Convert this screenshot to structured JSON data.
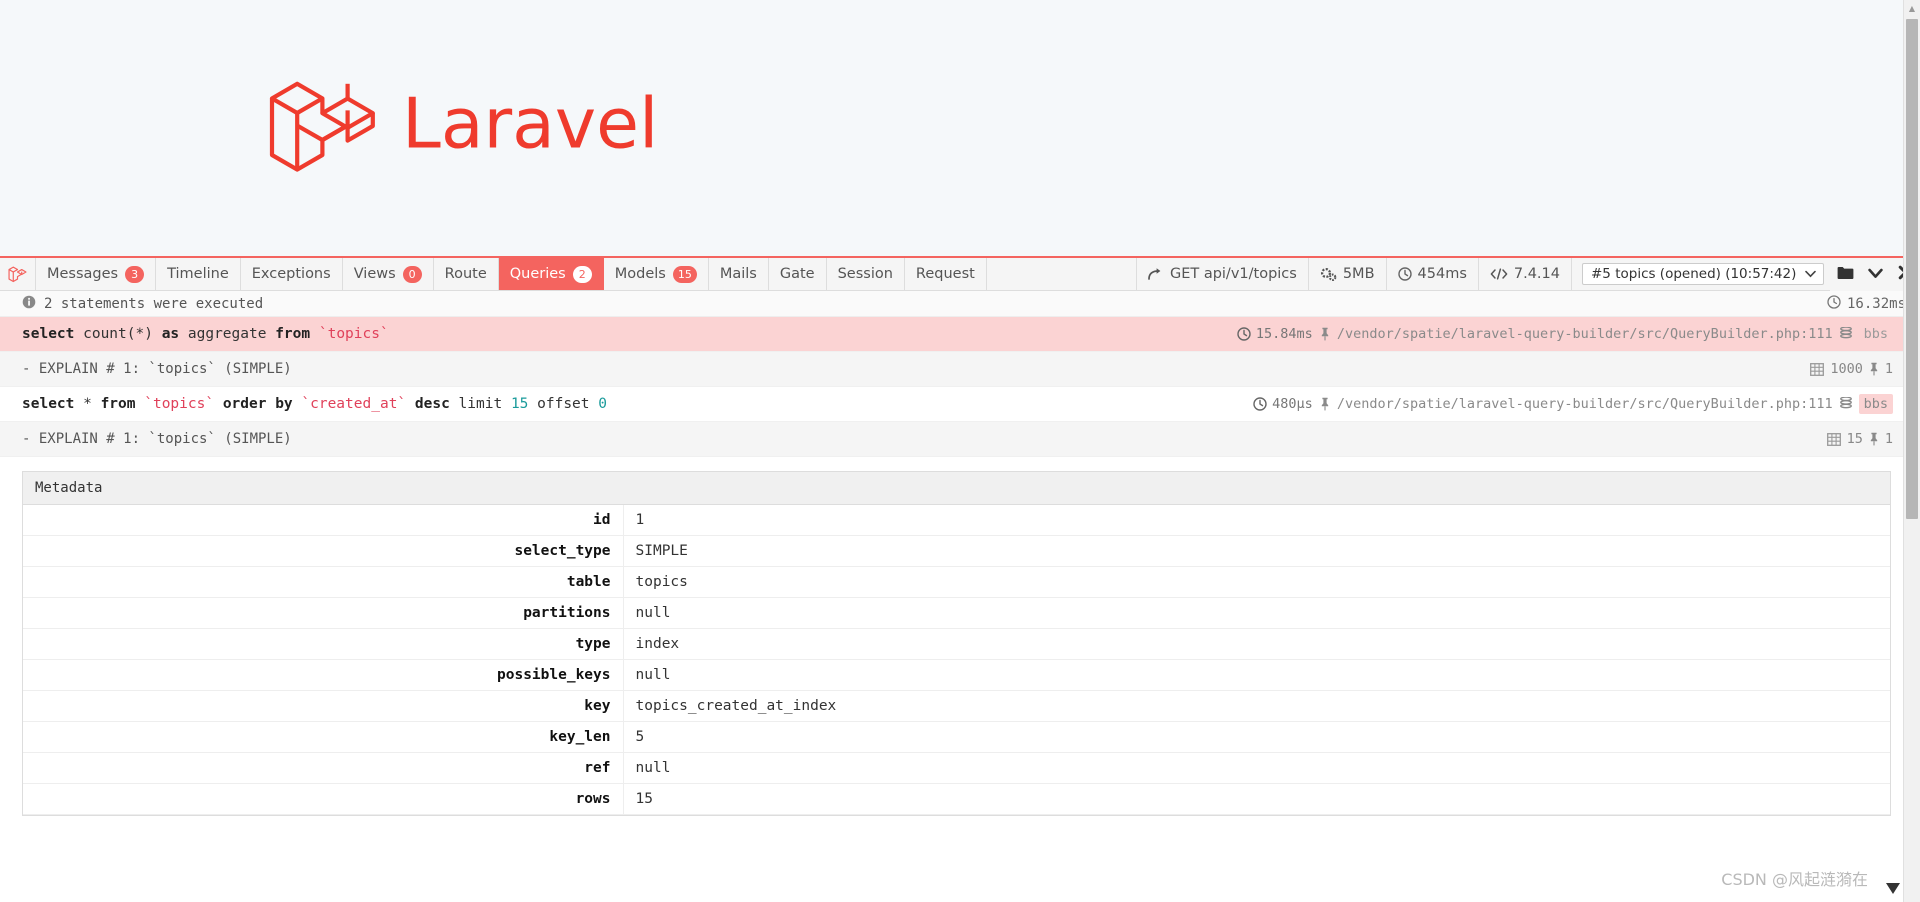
{
  "hero": {
    "logo_name": "laravel-logo",
    "wordmark": "Laravel",
    "brand_color": "#ef3b2d"
  },
  "debugbar": {
    "brand_icon": "laravel-logo-icon",
    "accent_color": "#f4645f",
    "tabs": [
      {
        "label": "Messages",
        "badge": "3",
        "active": false
      },
      {
        "label": "Timeline",
        "badge": null,
        "active": false
      },
      {
        "label": "Exceptions",
        "badge": null,
        "active": false
      },
      {
        "label": "Views",
        "badge": "0",
        "active": false
      },
      {
        "label": "Route",
        "badge": null,
        "active": false
      },
      {
        "label": "Queries",
        "badge": "2",
        "active": true
      },
      {
        "label": "Models",
        "badge": "15",
        "active": false
      },
      {
        "label": "Mails",
        "badge": null,
        "active": false
      },
      {
        "label": "Gate",
        "badge": null,
        "active": false
      },
      {
        "label": "Session",
        "badge": null,
        "active": false
      },
      {
        "label": "Request",
        "badge": null,
        "active": false
      }
    ],
    "info": [
      {
        "icon": "arrow-redirect-icon",
        "label": "GET api/v1/topics"
      },
      {
        "icon": "gears-icon",
        "label": "5MB"
      },
      {
        "icon": "clock-icon",
        "label": "454ms"
      },
      {
        "icon": "code-icon",
        "label": "7.4.14"
      }
    ],
    "dataset": {
      "selected": "#5 topics (opened) (10:57:42)",
      "options": [
        "#5 topics (opened) (10:57:42)"
      ],
      "caret_icon": "chevron-down-icon"
    },
    "controls": [
      {
        "icon": "folder-icon",
        "name": "open-datasets-button"
      },
      {
        "icon": "chevron-down-icon",
        "name": "minimize-button"
      },
      {
        "icon": "close-x-icon",
        "name": "close-button"
      }
    ]
  },
  "status": {
    "icon": "info-icon",
    "text": "2 statements were executed",
    "time_icon": "clock-icon",
    "total_time": "16.32ms"
  },
  "queries": [
    {
      "sql_tokens": [
        {
          "t": "select ",
          "c": "kw"
        },
        {
          "t": "count(*) ",
          "c": "plain"
        },
        {
          "t": "as ",
          "c": "kw"
        },
        {
          "t": "aggregate ",
          "c": "plain"
        },
        {
          "t": "from ",
          "c": "kw"
        },
        {
          "t": "`topics`",
          "c": "ident"
        }
      ],
      "slow": true,
      "time": "15.84ms",
      "time_icon": "clock-icon",
      "pin_icon": "pin-icon",
      "path": "/vendor/spatie/laravel-query-builder/src/QueryBuilder.php:111",
      "db_icon": "database-icon",
      "connection": "bbs",
      "connection_highlight": false,
      "explain": {
        "label": "- EXPLAIN # 1: `topics` (SIMPLE)",
        "rows_icon": "table-grid-icon",
        "rows": "1000",
        "pin_icon": "pin-icon",
        "pin_count": "1"
      }
    },
    {
      "sql_tokens": [
        {
          "t": "select ",
          "c": "kw"
        },
        {
          "t": "* ",
          "c": "plain"
        },
        {
          "t": "from ",
          "c": "kw"
        },
        {
          "t": "`topics` ",
          "c": "ident"
        },
        {
          "t": "order by ",
          "c": "kw"
        },
        {
          "t": "`created_at` ",
          "c": "ident"
        },
        {
          "t": "desc ",
          "c": "kw"
        },
        {
          "t": "limit ",
          "c": "plain"
        },
        {
          "t": "15 ",
          "c": "num"
        },
        {
          "t": "offset ",
          "c": "plain"
        },
        {
          "t": "0",
          "c": "num"
        }
      ],
      "slow": false,
      "time": "480µs",
      "time_icon": "clock-icon",
      "pin_icon": "pin-icon",
      "path": "/vendor/spatie/laravel-query-builder/src/QueryBuilder.php:111",
      "db_icon": "database-icon",
      "connection": "bbs",
      "connection_highlight": true,
      "explain": {
        "label": "- EXPLAIN # 1: `topics` (SIMPLE)",
        "rows_icon": "table-grid-icon",
        "rows": "15",
        "pin_icon": "pin-icon",
        "pin_count": "1"
      }
    }
  ],
  "metadata": {
    "title": "Metadata",
    "rows": [
      {
        "key": "id",
        "value": "1"
      },
      {
        "key": "select_type",
        "value": "SIMPLE"
      },
      {
        "key": "table",
        "value": "topics"
      },
      {
        "key": "partitions",
        "value": "null"
      },
      {
        "key": "type",
        "value": "index"
      },
      {
        "key": "possible_keys",
        "value": "null"
      },
      {
        "key": "key",
        "value": "topics_created_at_index"
      },
      {
        "key": "key_len",
        "value": "5"
      },
      {
        "key": "ref",
        "value": "null"
      },
      {
        "key": "rows",
        "value": "15"
      }
    ]
  },
  "watermark": {
    "text": "CSDN @风起涟漪在"
  }
}
